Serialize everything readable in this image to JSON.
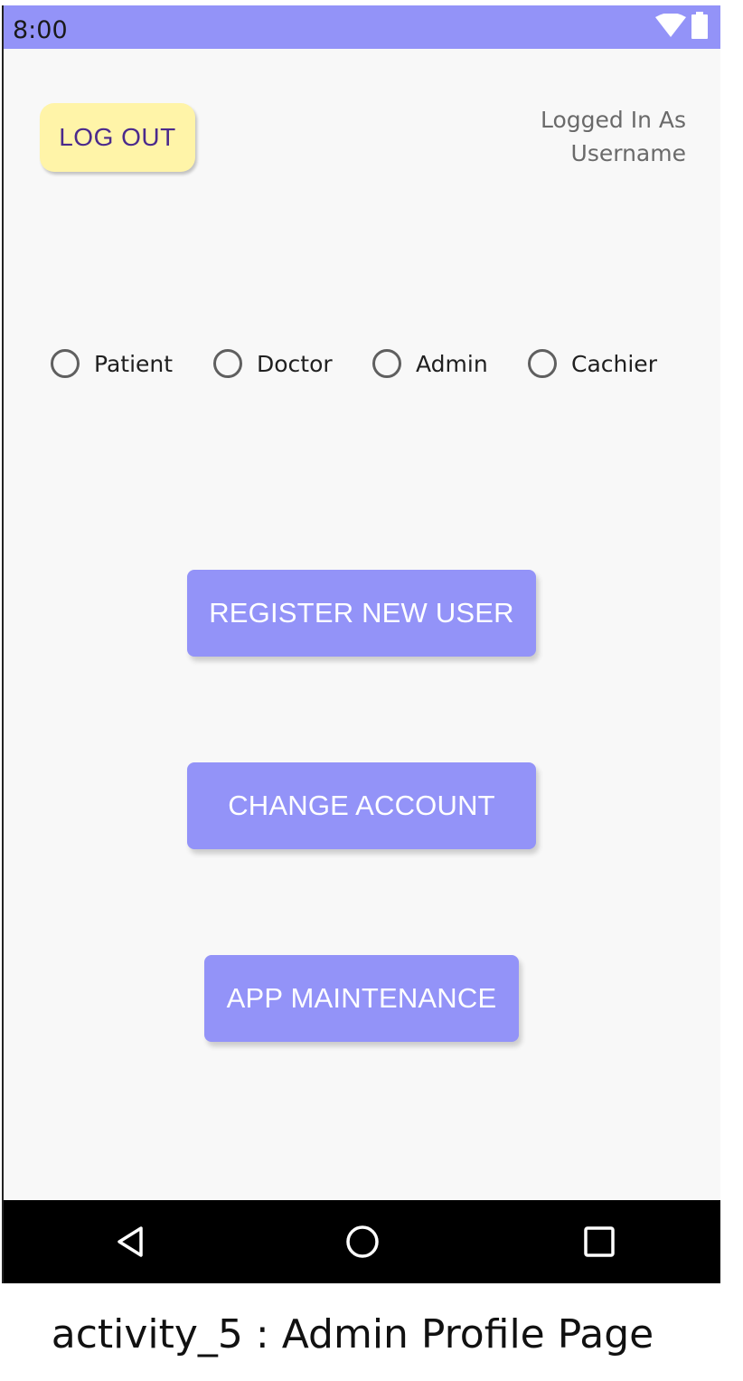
{
  "status_bar": {
    "time": "8:00",
    "icons": [
      "wifi-icon",
      "battery-icon"
    ],
    "background": "#9393f8"
  },
  "header": {
    "logout_label": "LOG OUT",
    "logged_in_line1": "Logged In As",
    "logged_in_line2": "Username"
  },
  "roles": {
    "options": [
      "Patient",
      "Doctor",
      "Admin",
      "Cachier"
    ],
    "selected": null
  },
  "actions": {
    "register_label": "REGISTER NEW USER",
    "change_label": "CHANGE ACCOUNT",
    "maintenance_label": "APP MAINTENANCE"
  },
  "nav": {
    "icons": [
      "back-icon",
      "home-icon",
      "recents-icon"
    ]
  },
  "caption": "activity_5 : Admin Profile Page",
  "colors": {
    "accent": "#9393f8",
    "logout_bg": "#fff4a8",
    "logout_text": "#4b2a8c",
    "background": "#f8f8f8"
  }
}
